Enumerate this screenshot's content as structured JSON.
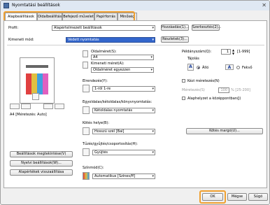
{
  "window": {
    "title": "Nyomtatási beállítások"
  },
  "tabs": [
    "Alapbeállítások",
    "Oldalbeállítás",
    "Befejező művelet",
    "Papírforrás",
    "Minőség"
  ],
  "profile": {
    "label": "Profil:",
    "value": "Alapértelmezett beállítások",
    "add_button": "Hozzáadás(1)...",
    "edit_button": "Szerkesztés(2)..."
  },
  "output": {
    "label": "Kimeneti mód:",
    "value": "Védett nyomtatás",
    "details_button": "Részletek(3)..."
  },
  "preview": {
    "caption": "A4 [Méretezés: Auto]"
  },
  "left_buttons": [
    "Beállítások megtekintése(V)",
    "Nyelvi beállítások(W)...",
    "Alapértékek visszaállítása"
  ],
  "page_size": {
    "label": "Oldalméret(S):",
    "value": "A4"
  },
  "output_size": {
    "label": "Kimeneti méret(A):",
    "value": "Oldalméret egyezzen"
  },
  "copies": {
    "label": "Példányszám(Q):",
    "value": "1",
    "range": "[1-999]"
  },
  "orientation": {
    "label": "Tájolás",
    "options": [
      "Álló",
      "Fekvő"
    ],
    "selected": "Álló"
  },
  "manual_scaling": {
    "label": "Kézi méretezés(N)",
    "scale_label": "Méretezés(S)",
    "scale_value": "100",
    "scale_range": "% [25-200]"
  },
  "watermark": {
    "label": "Alaphelyzet a középpontban(J)"
  },
  "layout": {
    "label": "Elrendezés(Y):",
    "value": "1-ről 1-re"
  },
  "duplex": {
    "label": "Egyoldalas/kétoldalas/könyvnyomtatás:",
    "value": "Kétoldalas nyomtatás"
  },
  "binding": {
    "label": "Kötés helye(B):",
    "value": "Hosszú szél [Bal]",
    "margin_button": "Kötés margó(U)..."
  },
  "finishing": {
    "label": "Tűzés/gyűjtés/csoportosítás(H):",
    "value": "Gyűjtés"
  },
  "color": {
    "label": "Színmód(C):",
    "value": "Automatikus [Színes/ff]"
  },
  "footer": {
    "ok": "OK",
    "cancel": "Mégse",
    "help": "Súgó"
  }
}
